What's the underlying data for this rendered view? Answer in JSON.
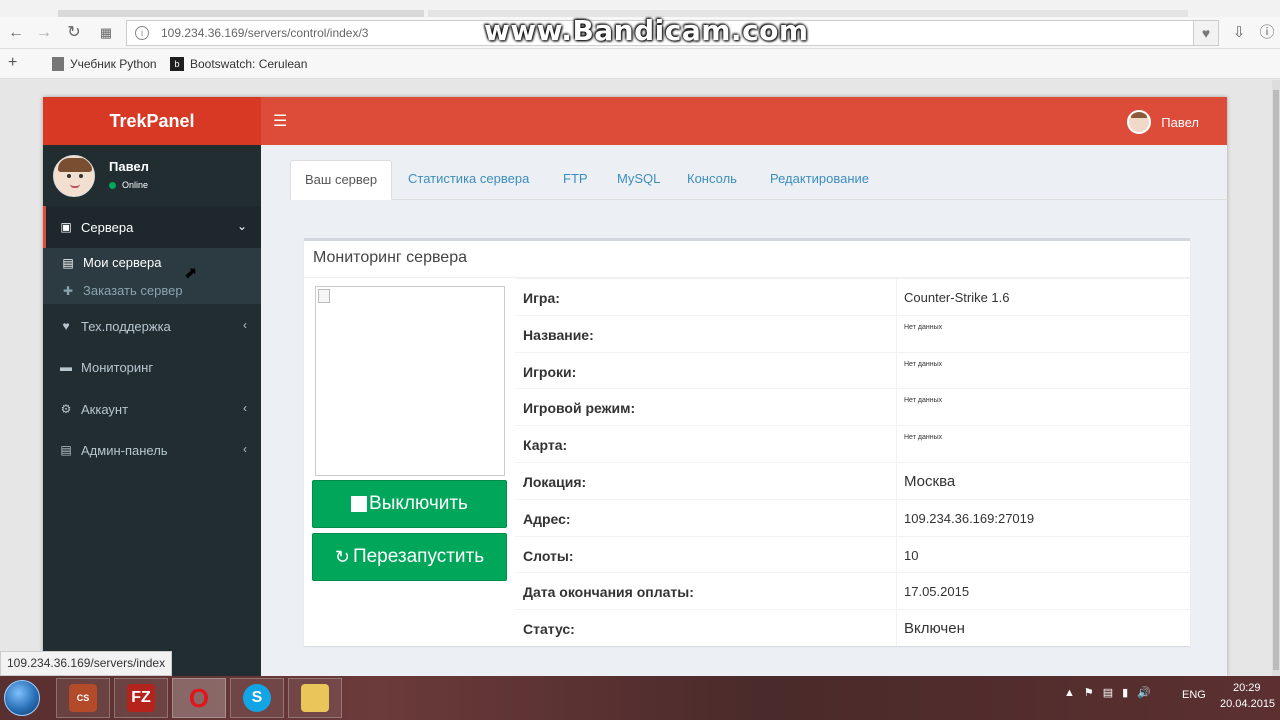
{
  "watermark": "www.Bandicam.com",
  "browser": {
    "url": "109.234.36.169/servers/control/index/3",
    "bookmarks": [
      "Учебник Python",
      "Bootswatch: Cerulean"
    ],
    "status_url": "109.234.36.169/servers/index"
  },
  "app": {
    "logo": "TrekPanel",
    "header_user": "Павел",
    "user_panel": {
      "name": "Павел",
      "status": "Online"
    },
    "menu": [
      {
        "label": "Сервера",
        "icon": "laptop-icon"
      },
      {
        "label": "Тех.поддержка",
        "icon": "heart-icon"
      },
      {
        "label": "Мониторинг",
        "icon": "folder-icon"
      },
      {
        "label": "Аккаунт",
        "icon": "cogs-icon"
      },
      {
        "label": "Админ-панель",
        "icon": "server-icon"
      }
    ],
    "submenu": [
      {
        "label": "Мои сервера",
        "icon": "server-icon"
      },
      {
        "label": "Заказать сервер",
        "icon": "plus-icon"
      }
    ],
    "tabs": [
      "Ваш сервер",
      "Статистика сервера",
      "FTP",
      "MySQL",
      "Консоль",
      "Редактирование"
    ],
    "box_title": "Мониторинг сервера",
    "buttons": {
      "stop": "Выключить",
      "restart": "Перезапустить"
    },
    "info_rows": [
      {
        "label": "Игра:",
        "value": "Counter-Strike 1.6"
      },
      {
        "label": "Название:",
        "value": "Нет данных"
      },
      {
        "label": "Игроки:",
        "value": "Нет данных"
      },
      {
        "label": "Игровой режим:",
        "value": "Нет данных"
      },
      {
        "label": "Карта:",
        "value": "Нет данных"
      },
      {
        "label": "Локация:",
        "value": "Москва"
      },
      {
        "label": "Адрес:",
        "value": "109.234.36.169:27019"
      },
      {
        "label": "Слоты:",
        "value": "10"
      },
      {
        "label": "Дата окончания оплаты:",
        "value": "17.05.2015"
      },
      {
        "label": "Статус:",
        "value": "Включен"
      }
    ]
  },
  "taskbar": {
    "lang": "ENG",
    "time": "20:29",
    "date": "20.04.2015"
  },
  "colors": {
    "header": "#dd4b39",
    "sidebar": "#222d32",
    "green": "#00a65a",
    "link": "#3c8dbc"
  }
}
